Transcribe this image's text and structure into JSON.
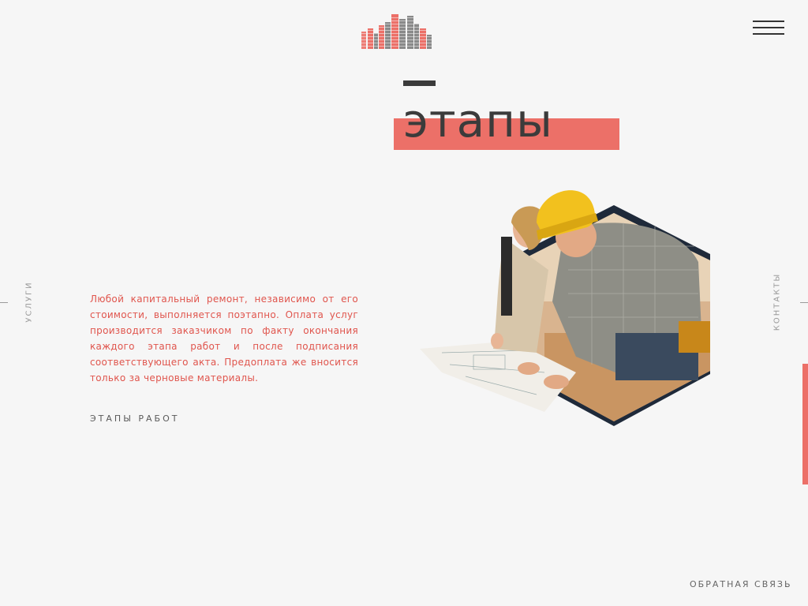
{
  "header": {
    "logo_icon": "buildings-logo-icon",
    "menu_icon": "hamburger-menu-icon"
  },
  "section": {
    "title": "этапы",
    "description": "Любой капитальный ремонт, независимо от его стоимости, выполняется поэтапно. Оплата услуг производится заказчиком по факту окончания каждого этапа работ и после подписания соответствующего акта. Предоплата же вносится только за черновые материалы.",
    "link_label": "ЭТАПЫ РАБОТ"
  },
  "side_nav": {
    "left_label": "УСЛУГИ",
    "right_label": "КОНТАКТЫ"
  },
  "footer": {
    "feedback_label": "ОБРАТНАЯ СВЯЗЬ",
    "feedback_dot": "."
  },
  "colors": {
    "accent": "#ec7068",
    "dark": "#3b3b3b",
    "navy": "#1f2a3a",
    "background": "#f6f6f6"
  }
}
